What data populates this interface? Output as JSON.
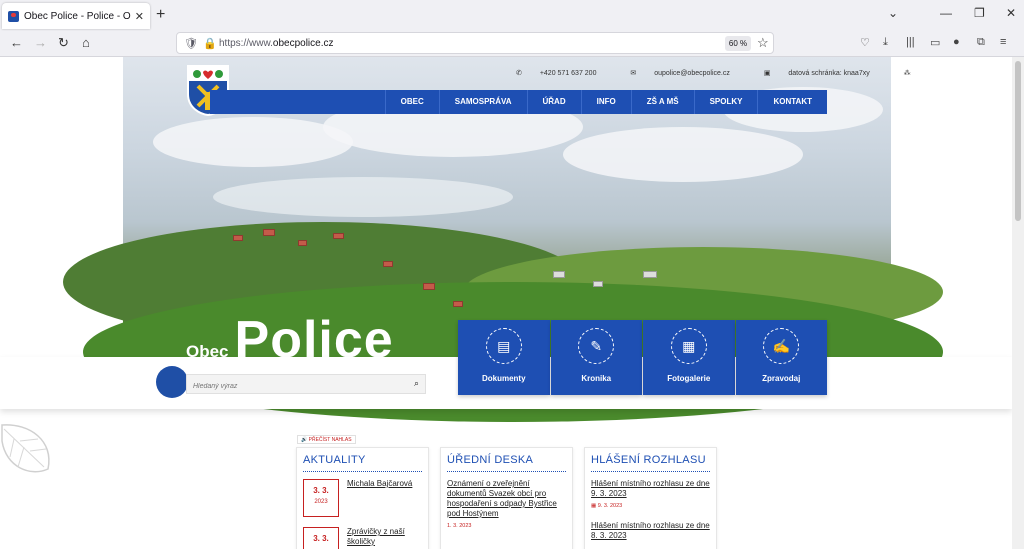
{
  "browser": {
    "tab_title": "Obec Police - Police - Obec prá",
    "url_prefix": "https://www.",
    "url_host": "obecpolice.cz",
    "zoom": "60 %"
  },
  "site": {
    "contact_phone": "+420 571 637 200",
    "contact_email": "oupolice@obecpolice.cz",
    "contact_box": "datová schránka: knaa7xy",
    "nav": [
      "OBEC",
      "SAMOSPRÁVA",
      "ÚŘAD",
      "INFO",
      "ZŠ A MŠ",
      "SPOLKY",
      "KONTAKT"
    ],
    "title_small": "Obec",
    "title_big": "Police",
    "search_placeholder": "Hledaný výraz",
    "tiles": [
      {
        "label": "Dokumenty",
        "icon": "document-icon"
      },
      {
        "label": "Kronika",
        "icon": "chronicle-icon"
      },
      {
        "label": "Fotogalerie",
        "icon": "gallery-icon"
      },
      {
        "label": "Zpravodaj",
        "icon": "newsletter-icon"
      }
    ],
    "listen": "PŘEČÍST NAHLAS"
  },
  "aktuality": {
    "title": "AKTUALITY",
    "items": [
      {
        "day": "3. 3.",
        "year": "2023",
        "text": "Michala Bajčarová"
      },
      {
        "day": "3. 3.",
        "year": "",
        "text": "Zprávičky z naší školičky"
      }
    ]
  },
  "deska": {
    "title": "ÚŘEDNÍ DESKA",
    "items": [
      {
        "text": "Oznámení o zveřejnění dokumentů Svazek obcí pro hospodaření s odpady Bystřice pod Hostýnem",
        "date": "1. 3. 2023"
      }
    ]
  },
  "rozhlas": {
    "title": "HLÁŠENÍ ROZHLASU",
    "items": [
      {
        "text": "Hlášení místního rozhlasu ze dne 9. 3. 2023",
        "date": "9. 3. 2023"
      },
      {
        "text": "Hlášení místního rozhlasu ze dne 8. 3. 2023",
        "date": ""
      }
    ]
  }
}
